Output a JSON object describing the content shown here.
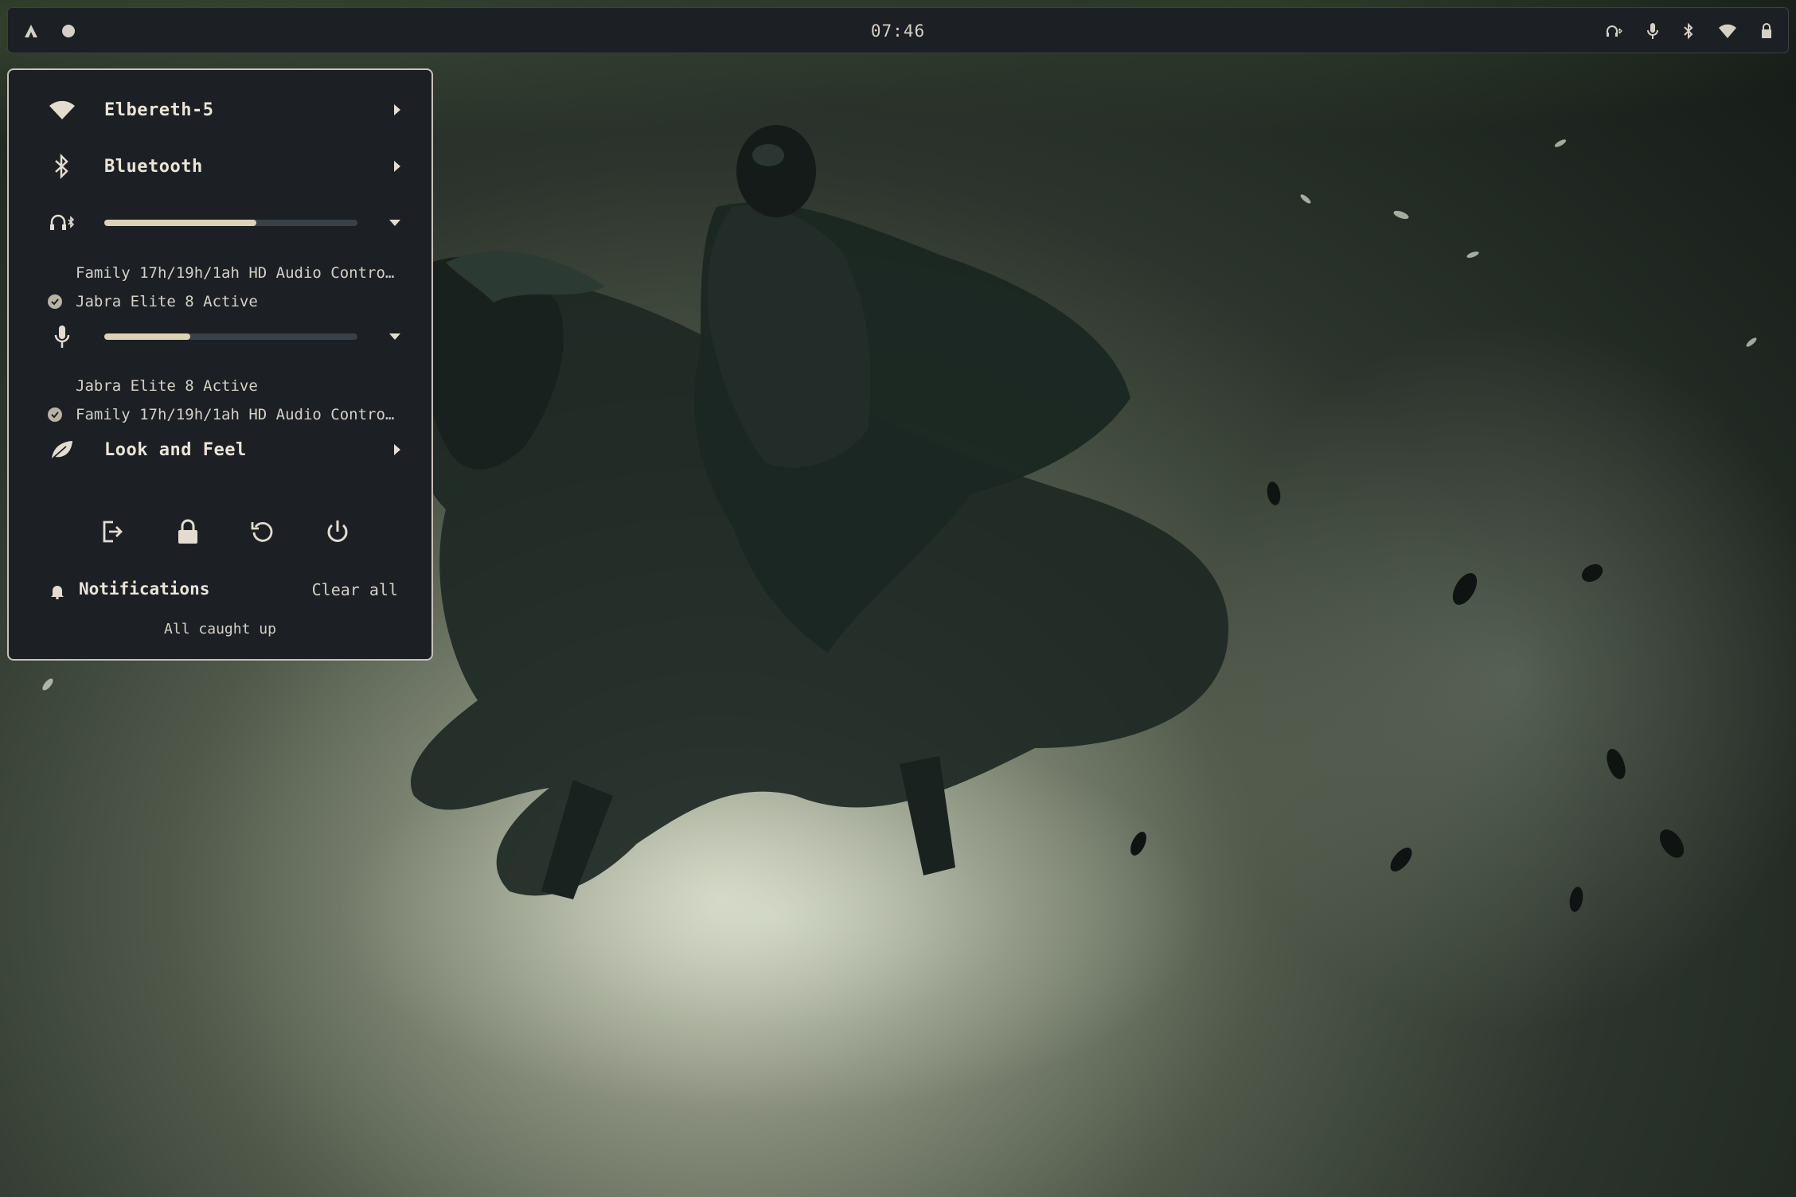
{
  "topbar": {
    "clock": "07:46"
  },
  "quick_settings": {
    "wifi": {
      "label": "Elbereth-5"
    },
    "bluetooth": {
      "label": "Bluetooth"
    },
    "output": {
      "volume_fraction": 0.6,
      "devices": [
        {
          "name": "Family 17h/19h/1ah HD Audio Contro…",
          "selected": false
        },
        {
          "name": "Jabra Elite 8 Active",
          "selected": true
        }
      ]
    },
    "input": {
      "volume_fraction": 0.34,
      "devices": [
        {
          "name": "Jabra Elite 8 Active",
          "selected": false
        },
        {
          "name": "Family 17h/19h/1ah HD Audio Contro…",
          "selected": true
        }
      ]
    },
    "look_and_feel": {
      "label": "Look and Feel"
    },
    "notifications": {
      "title": "Notifications",
      "clear_label": "Clear all",
      "empty_text": "All caught up"
    }
  },
  "colors": {
    "panel_bg": "#1c2025",
    "panel_border": "#c9c2b3",
    "accent_fill": "#ddd1b6",
    "text": "#e3dccf"
  }
}
